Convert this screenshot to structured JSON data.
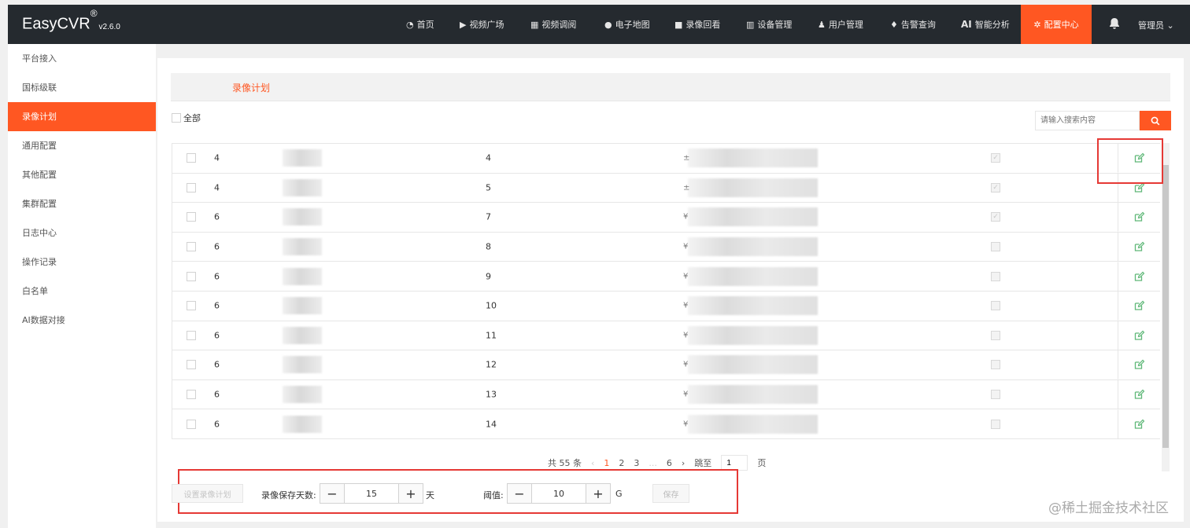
{
  "app": {
    "name": "EasyCVR",
    "reg": "®",
    "version": "v2.6.0"
  },
  "nav": [
    {
      "label": "首页",
      "icon": "dashboard-icon",
      "glyph": "◔"
    },
    {
      "label": "视频广场",
      "icon": "play-icon",
      "glyph": "▶"
    },
    {
      "label": "视频调阅",
      "icon": "grid-icon",
      "glyph": "▦"
    },
    {
      "label": "电子地图",
      "icon": "map-pin-icon",
      "glyph": "●"
    },
    {
      "label": "录像回看",
      "icon": "video-camera-icon",
      "glyph": "■"
    },
    {
      "label": "设备管理",
      "icon": "device-icon",
      "glyph": "▥"
    },
    {
      "label": "用户管理",
      "icon": "user-icon",
      "glyph": "♟"
    },
    {
      "label": "告警查询",
      "icon": "alarm-icon",
      "glyph": "♦"
    },
    {
      "label": "智能分析",
      "icon": "ai-icon",
      "glyph": "AI"
    }
  ],
  "nav_active": {
    "label": "配置中心",
    "glyph": "✲"
  },
  "user": {
    "label": "管理员"
  },
  "sidebar": [
    {
      "label": "平台接入"
    },
    {
      "label": "国标级联"
    },
    {
      "label": "录像计划",
      "active": true
    },
    {
      "label": "通用配置"
    },
    {
      "label": "其他配置"
    },
    {
      "label": "集群配置"
    },
    {
      "label": "日志中心"
    },
    {
      "label": "操作记录"
    },
    {
      "label": "白名单"
    },
    {
      "label": "AI数据对接"
    }
  ],
  "tab": {
    "label": "录像计划"
  },
  "select_all": {
    "label": "全部"
  },
  "search": {
    "placeholder": "请输入搜索内容"
  },
  "rows": [
    {
      "a": "4",
      "b": "4",
      "c": "±",
      "flag": true
    },
    {
      "a": "4",
      "b": "5",
      "c": "±",
      "flag": true
    },
    {
      "a": "6",
      "b": "7",
      "c": "¥",
      "flag": true
    },
    {
      "a": "6",
      "b": "8",
      "c": "¥",
      "flag": false
    },
    {
      "a": "6",
      "b": "9",
      "c": "¥",
      "flag": false
    },
    {
      "a": "6",
      "b": "10",
      "c": "¥",
      "flag": false
    },
    {
      "a": "6",
      "b": "11",
      "c": "¥",
      "flag": false
    },
    {
      "a": "6",
      "b": "12",
      "c": "¥",
      "flag": false
    },
    {
      "a": "6",
      "b": "13",
      "c": "¥",
      "flag": false
    },
    {
      "a": "6",
      "b": "14",
      "c": "¥",
      "flag": false
    }
  ],
  "pagination": {
    "total": "共 55 条",
    "prev": "‹",
    "pages": [
      "1",
      "2",
      "3"
    ],
    "ellipsis": "...",
    "last": "6",
    "next": "›",
    "jump_label": "跳至",
    "jump_value": "1",
    "page_unit": "页"
  },
  "footer": {
    "set_button": "设置录像计划",
    "days_label": "录像保存天数:",
    "days_value": "15",
    "days_unit": "天",
    "threshold_label": "阈值:",
    "threshold_value": "10",
    "threshold_unit": "G",
    "save_button": "保存"
  },
  "watermark": "@稀土掘金技术社区",
  "colors": {
    "accent": "#ff5722",
    "topbar": "#252a2f",
    "edit": "#5fb878",
    "highlight": "#e53935"
  }
}
